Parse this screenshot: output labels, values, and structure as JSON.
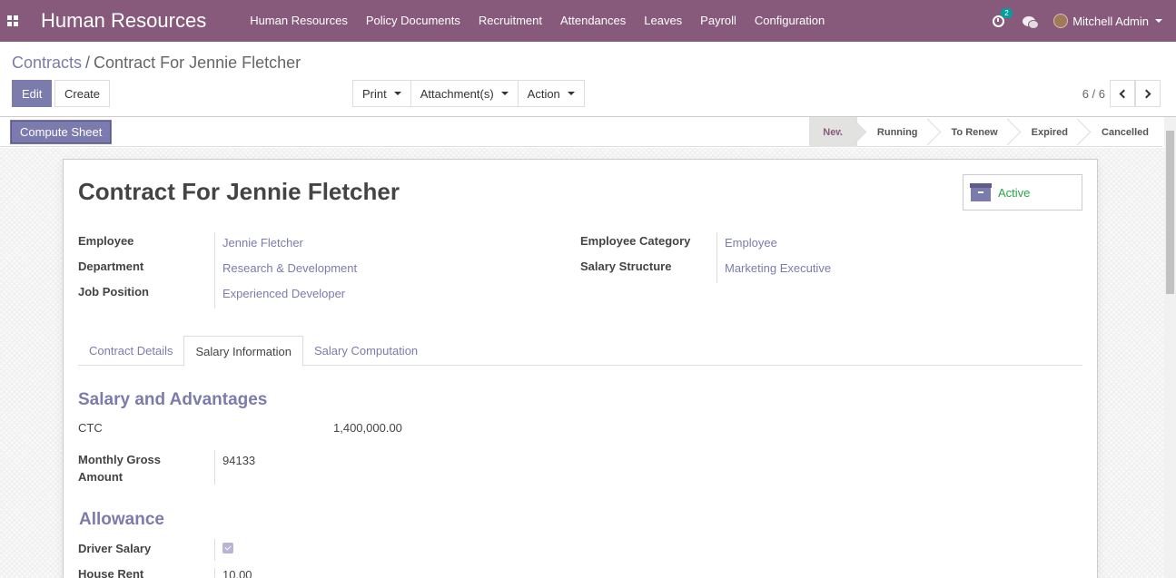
{
  "navbar": {
    "brand": "Human Resources",
    "menu": [
      "Human Resources",
      "Policy Documents",
      "Recruitment",
      "Attendances",
      "Leaves",
      "Payroll",
      "Configuration"
    ],
    "activity_count": "2",
    "user_name": "Mitchell Admin"
  },
  "control_panel": {
    "breadcrumb_parent": "Contracts",
    "breadcrumb_separator": "/",
    "breadcrumb_current": "Contract For Jennie Fletcher",
    "edit_label": "Edit",
    "create_label": "Create",
    "print_label": "Print",
    "attachments_label": "Attachment(s)",
    "action_label": "Action",
    "pager_value": "6 / 6"
  },
  "statusbar": {
    "compute_label": "Compute Sheet",
    "stages": [
      "New",
      "Running",
      "To Renew",
      "Expired",
      "Cancelled"
    ],
    "active_stage": "New"
  },
  "sheet": {
    "title": "Contract For Jennie Fletcher",
    "active_label": "Active",
    "left_fields": [
      {
        "label": "Employee",
        "value": "Jennie Fletcher"
      },
      {
        "label": "Department",
        "value": "Research & Development"
      },
      {
        "label": "Job Position",
        "value": "Experienced Developer"
      }
    ],
    "right_fields": [
      {
        "label": "Employee Category",
        "value": "Employee"
      },
      {
        "label": "Salary Structure",
        "value": "Marketing Executive"
      }
    ],
    "tabs": [
      "Contract Details",
      "Salary Information",
      "Salary Computation"
    ],
    "active_tab": "Salary Information",
    "salary_section_title": "Salary and Advantages",
    "ctc_label": "CTC",
    "ctc_value": "1,400,000.00",
    "monthly_gross_label": "Monthly Gross Amount",
    "monthly_gross_value": "94133",
    "allowance_title": "Allowance",
    "driver_salary_label": "Driver Salary",
    "driver_salary_checked": true,
    "house_rent_label": "House Rent",
    "house_rent_value": "10.00"
  },
  "colors": {
    "navbar": "#875a7b",
    "primary": "#7c7bad",
    "active_green": "#28a745"
  }
}
